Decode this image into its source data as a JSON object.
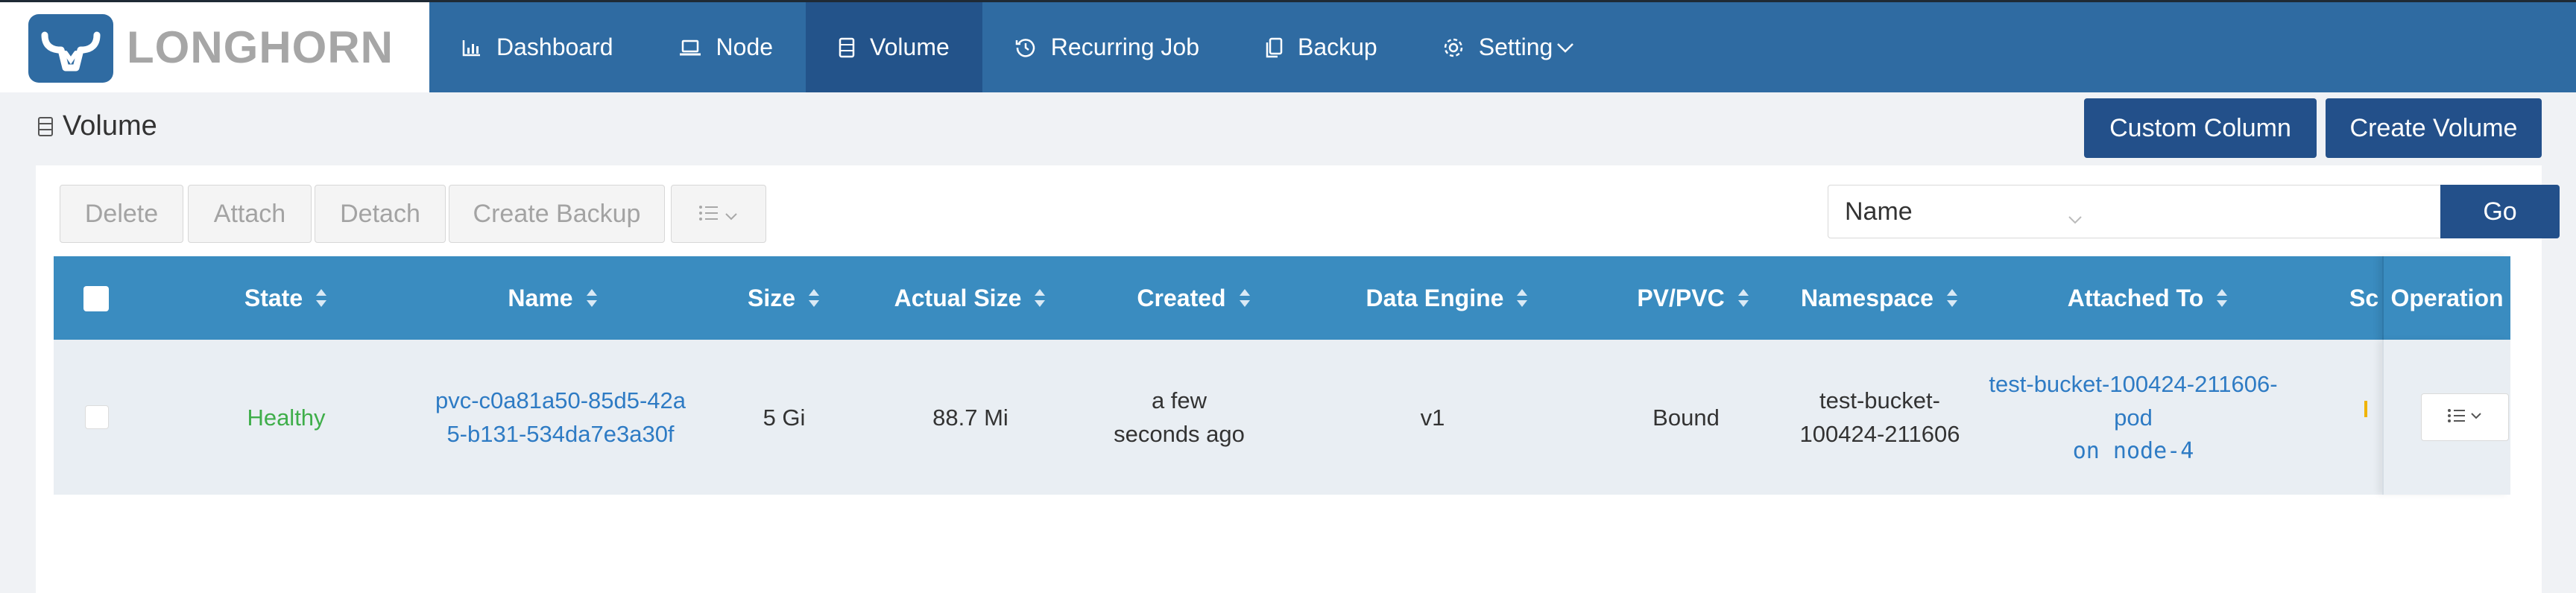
{
  "brand": {
    "name": "LONGHORN",
    "logo_color": "#2f6ba2"
  },
  "nav": {
    "items": [
      {
        "label": "Dashboard",
        "icon": "bar-chart-icon",
        "active": false
      },
      {
        "label": "Node",
        "icon": "laptop-icon",
        "active": false
      },
      {
        "label": "Volume",
        "icon": "database-icon",
        "active": true
      },
      {
        "label": "Recurring Job",
        "icon": "history-icon",
        "active": false
      },
      {
        "label": "Backup",
        "icon": "copy-icon",
        "active": false
      },
      {
        "label": "Setting",
        "icon": "gear-icon",
        "active": false
      }
    ]
  },
  "page": {
    "title": "Volume",
    "custom_column_label": "Custom Column",
    "create_volume_label": "Create Volume"
  },
  "toolbar": {
    "delete_label": "Delete",
    "attach_label": "Attach",
    "detach_label": "Detach",
    "create_backup_label": "Create Backup"
  },
  "search": {
    "field_selected": "Name",
    "query": "",
    "go_label": "Go"
  },
  "table": {
    "columns": [
      "State",
      "Name",
      "Size",
      "Actual Size",
      "Created",
      "Data Engine",
      "PV/PVC",
      "Namespace",
      "Attached To",
      "Sc",
      "Operation"
    ],
    "rows": [
      {
        "state": "Healthy",
        "name_line1": "pvc-c0a81a50-85d5-42a",
        "name_line2": "5-b131-534da7e3a30f",
        "size": "5 Gi",
        "actual_size": "88.7 Mi",
        "created_line1": "a few",
        "created_line2": "seconds ago",
        "data_engine": "v1",
        "pv_pvc": "Bound",
        "namespace_line1": "test-bucket-",
        "namespace_line2": "100424-211606",
        "attached_to_line1": "test-bucket-100424-211606-",
        "attached_to_line2": "pod",
        "attached_node": "on node-4"
      }
    ]
  },
  "colors": {
    "header_bg": "#2f6ba2",
    "nav_active": "#23538a",
    "primary_button": "#23508a",
    "table_header": "#3a8cc0",
    "healthy": "#3fae4a",
    "link": "#2e7bc4"
  }
}
